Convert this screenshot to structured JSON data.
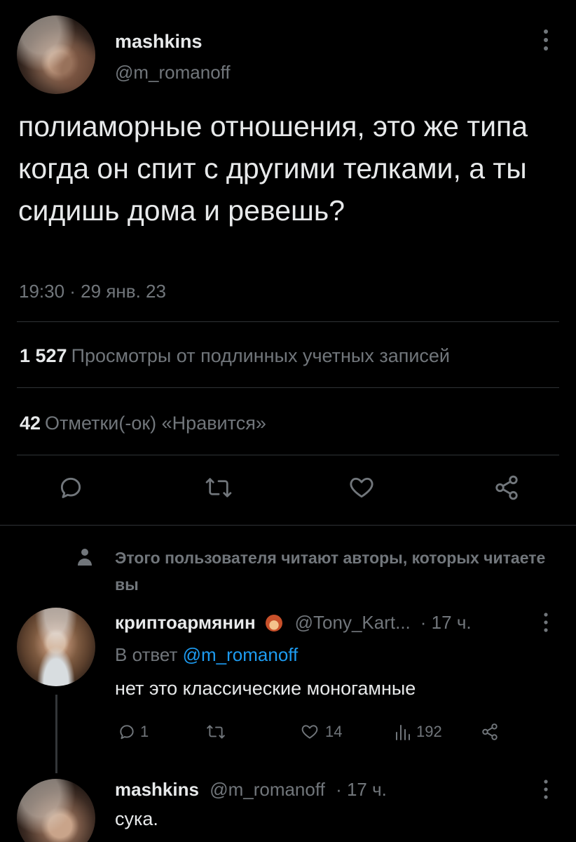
{
  "tweet": {
    "display_name": "mashkins",
    "handle": "@m_romanoff",
    "text": "полиаморные отношения, это же типа когда он спит с другими телками, а ты сидишь дома и ревешь?",
    "timestamp": "19:30 · 29 янв. 23",
    "views_count": "1 527",
    "views_label": "Просмотры от подлинных учетных записей",
    "likes_count": "42",
    "likes_label": "Отметки(-ок) «Нравится»"
  },
  "social_context": {
    "text": "Этого пользователя читают авторы, которых читаете вы"
  },
  "reply1": {
    "display_name": "криптоармянин",
    "handle": "@Tony_Kart...",
    "time": "· 17 ч.",
    "in_reply_prefix": "В ответ",
    "in_reply_handle": "@m_romanoff",
    "text": "нет это классические моногамные",
    "reply_count": "1",
    "like_count": "14",
    "view_count": "192"
  },
  "reply2": {
    "display_name": "mashkins",
    "handle": "@m_romanoff",
    "time": "· 17 ч.",
    "text": "сука."
  },
  "colors": {
    "background": "#000000",
    "text": "#e7e9ea",
    "secondary": "#71767b",
    "link": "#1d9bf0",
    "divider": "#2f3336"
  }
}
